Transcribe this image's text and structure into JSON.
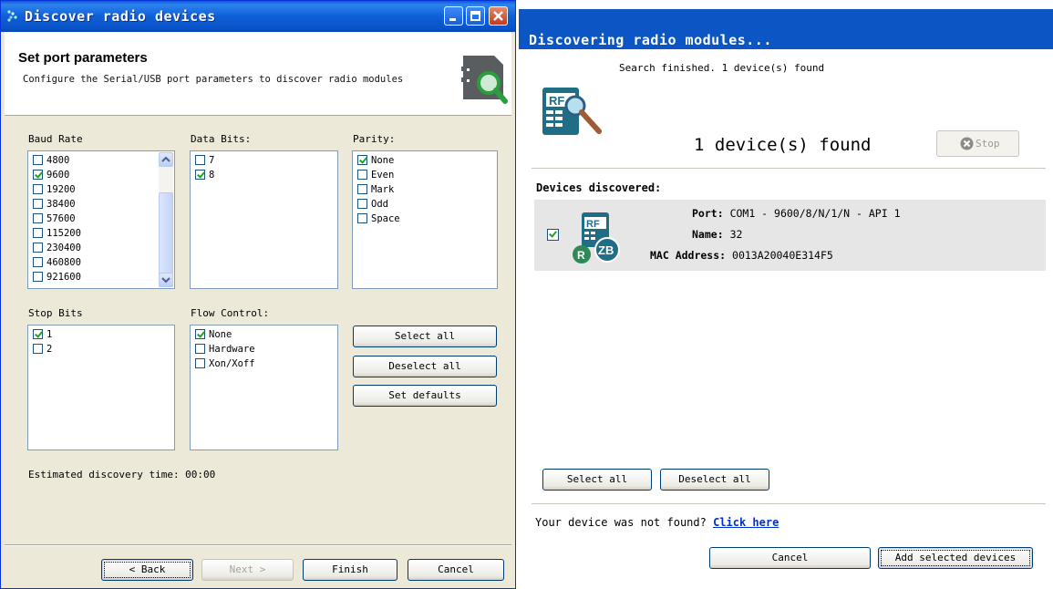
{
  "left_window": {
    "title": "Discover radio devices",
    "header_title": "Set port parameters",
    "header_desc": "Configure the Serial/USB port parameters to discover radio modules",
    "baud_rate": {
      "label": "Baud Rate",
      "options": [
        {
          "label": "4800",
          "checked": false
        },
        {
          "label": "9600",
          "checked": true
        },
        {
          "label": "19200",
          "checked": false
        },
        {
          "label": "38400",
          "checked": false
        },
        {
          "label": "57600",
          "checked": false
        },
        {
          "label": "115200",
          "checked": false
        },
        {
          "label": "230400",
          "checked": false
        },
        {
          "label": "460800",
          "checked": false
        },
        {
          "label": "921600",
          "checked": false
        }
      ]
    },
    "data_bits": {
      "label": "Data Bits:",
      "options": [
        {
          "label": "7",
          "checked": false
        },
        {
          "label": "8",
          "checked": true
        }
      ]
    },
    "parity": {
      "label": "Parity:",
      "options": [
        {
          "label": "None",
          "checked": true
        },
        {
          "label": "Even",
          "checked": false
        },
        {
          "label": "Mark",
          "checked": false
        },
        {
          "label": "Odd",
          "checked": false
        },
        {
          "label": "Space",
          "checked": false
        }
      ]
    },
    "stop_bits": {
      "label": "Stop Bits",
      "options": [
        {
          "label": "1",
          "checked": true
        },
        {
          "label": "2",
          "checked": false
        }
      ]
    },
    "flow_control": {
      "label": "Flow Control:",
      "options": [
        {
          "label": "None",
          "checked": true
        },
        {
          "label": "Hardware",
          "checked": false
        },
        {
          "label": "Xon/Xoff",
          "checked": false
        }
      ]
    },
    "select_all": "Select all",
    "deselect_all": "Deselect all",
    "set_defaults": "Set defaults",
    "estimated_time": "Estimated discovery time: 00:00",
    "back": "< Back",
    "next": "Next >",
    "finish": "Finish",
    "cancel": "Cancel"
  },
  "right_window": {
    "title": "Discovering radio modules...",
    "status": "Search finished. 1 device(s) found",
    "count": "1 device(s) found",
    "stop": "Stop",
    "devices_heading": "Devices discovered:",
    "device": {
      "checked": true,
      "port_label": "Port:",
      "port_value": "COM1 - 9600/8/N/1/N - API 1",
      "name_label": "Name:",
      "name_value": "32",
      "mac_label": "MAC Address:",
      "mac_value": "0013A20040E314F5"
    },
    "select_all": "Select all",
    "deselect_all": "Deselect all",
    "not_found": "Your device was not found?",
    "click_here": "Click here",
    "cancel": "Cancel",
    "add_selected": "Add selected devices"
  },
  "colors": {
    "xp_title_blue": "#0b55c4",
    "check_green": "#21a121",
    "link_blue": "#0033cc"
  }
}
